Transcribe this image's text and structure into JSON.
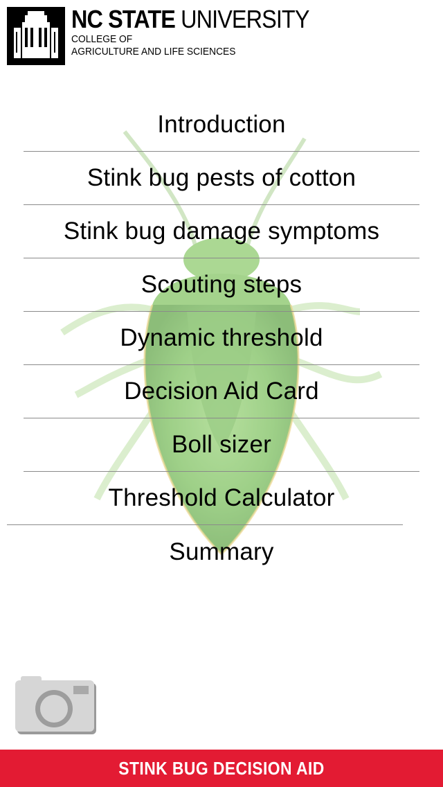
{
  "header": {
    "university_bold": "NC STATE",
    "university_rest": "UNIVERSITY",
    "college_line1": "COLLEGE OF",
    "college_line2": "AGRICULTURE AND LIFE SCIENCES",
    "logo_icon": "belltower-logo-icon"
  },
  "menu": {
    "items": [
      {
        "label": "Introduction"
      },
      {
        "label": "Stink bug pests of cotton"
      },
      {
        "label": "Stink bug damage symptoms"
      },
      {
        "label": "Scouting steps"
      },
      {
        "label": "Dynamic threshold"
      },
      {
        "label": "Decision Aid Card"
      },
      {
        "label": "Boll sizer"
      },
      {
        "label": "Threshold Calculator"
      },
      {
        "label": "Summary"
      }
    ]
  },
  "camera": {
    "icon": "camera-icon"
  },
  "footer": {
    "title": "STINK BUG DECISION AID"
  },
  "colors": {
    "brand_red": "#e31b33",
    "divider": "#8a8a8a",
    "bug_green": "#5aa83a"
  }
}
